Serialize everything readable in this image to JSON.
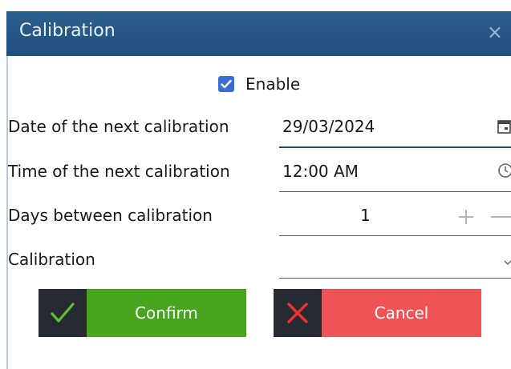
{
  "dialog": {
    "title": "Calibration",
    "close_glyph": "×"
  },
  "enable": {
    "label": "Enable",
    "checked": true
  },
  "fields": {
    "date": {
      "label": "Date of the next calibration",
      "value": "29/03/2024",
      "icon": "calendar-icon"
    },
    "time": {
      "label": "Time of the next calibration",
      "value": "12:00 AM",
      "icon": "clock-icon"
    },
    "days": {
      "label": "Days between calibration",
      "value": "1",
      "increment_icon": "plus-icon",
      "decrement_icon": "minus-icon"
    },
    "calibration": {
      "label": "Calibration",
      "value": "",
      "icon": "chevron-down-icon"
    }
  },
  "buttons": {
    "confirm": {
      "label": "Confirm",
      "icon": "checkmark-icon",
      "color": "#47a51d",
      "icon_color": "#5cc02a"
    },
    "cancel": {
      "label": "Cancel",
      "icon": "x-icon",
      "color": "#f05355",
      "icon_color": "#e8332f"
    }
  },
  "colors": {
    "titlebar": "#2a5b8a",
    "checkbox": "#3a6cd1",
    "active_underline": "#34418e"
  }
}
